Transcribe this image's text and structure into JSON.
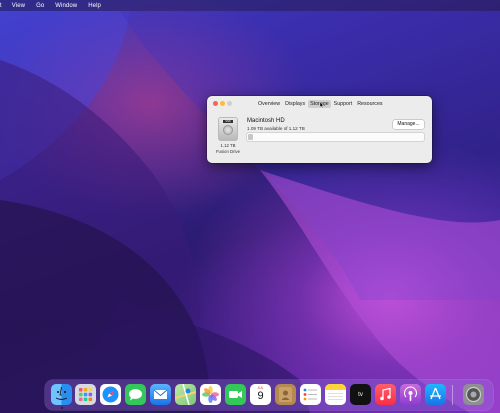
{
  "menubar": {
    "items": [
      "t",
      "View",
      "Go",
      "Window",
      "Help"
    ]
  },
  "window": {
    "tabs": [
      "Overview",
      "Displays",
      "Storage",
      "Support",
      "Resources"
    ],
    "active_tab": "Storage",
    "disk": {
      "icon_label": "SSD",
      "capacity": "1.12 TB",
      "type": "Fusion Drive",
      "name": "Macintosh HD",
      "available": "1.09 TB available of 1.12 TB",
      "used_fraction": 0.03
    },
    "manage_label": "Manage..."
  },
  "dock": {
    "calendar_month": "JUL",
    "calendar_day": "9",
    "apps": [
      "finder-icon",
      "launchpad-icon",
      "safari-icon",
      "messages-icon",
      "mail-icon",
      "maps-icon",
      "photos-icon",
      "facetime-icon",
      "calendar-icon",
      "contacts-icon",
      "reminders-icon",
      "notes-icon",
      "apple-tv-icon",
      "music-icon",
      "podcasts-icon",
      "app-store-icon",
      "system-preferences-icon"
    ]
  }
}
